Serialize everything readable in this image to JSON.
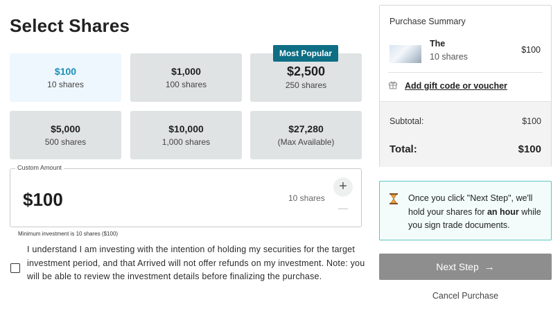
{
  "page": {
    "title": "Select Shares"
  },
  "tiles": [
    {
      "amount": "$100",
      "shares": "10 shares",
      "selected": true
    },
    {
      "amount": "$1,000",
      "shares": "100 shares"
    },
    {
      "amount": "$2,500",
      "shares": "250 shares",
      "badge": "Most Popular"
    },
    {
      "amount": "$5,000",
      "shares": "500 shares"
    },
    {
      "amount": "$10,000",
      "shares": "1,000 shares"
    },
    {
      "amount": "$27,280",
      "shares": "(Max Available)"
    }
  ],
  "custom_amount": {
    "label": "Custom Amount",
    "value": "$100",
    "shares": "10 shares",
    "plus_symbol": "+",
    "minus_symbol": "—",
    "minimum_note": "Minimum investment is 10 shares ($100)"
  },
  "consent": {
    "checked": false,
    "text": "I understand I am investing with the intention of holding my securities for the target investment period, and that Arrived will not offer refunds on my investment. Note: you will be able to review the investment details before finalizing the purchase."
  },
  "summary": {
    "title": "Purchase Summary",
    "item_name": "The",
    "item_shares": "10 shares",
    "item_price": "$100",
    "gift_link": "Add gift code or voucher",
    "gift_icon": "gift-icon",
    "subtotal_label": "Subtotal:",
    "subtotal_value": "$100",
    "total_label": "Total:",
    "total_value": "$100"
  },
  "hold_notice": {
    "icon": "hourglass-icon",
    "text_before": "Once you click \"Next Step\", we'll hold your shares for ",
    "text_bold": "an hour",
    "text_after": " while you sign trade documents."
  },
  "actions": {
    "next_label": "Next Step",
    "next_arrow": "→",
    "cancel_label": "Cancel Purchase"
  },
  "colors": {
    "selected_tile_bg": "#eef7fd",
    "selected_tile_text": "#1a8fb7",
    "tile_bg": "#dfe3e3",
    "badge_bg": "#0e6e84",
    "notice_border": "#5cc6c2",
    "next_button_bg": "#8e8e8e"
  }
}
